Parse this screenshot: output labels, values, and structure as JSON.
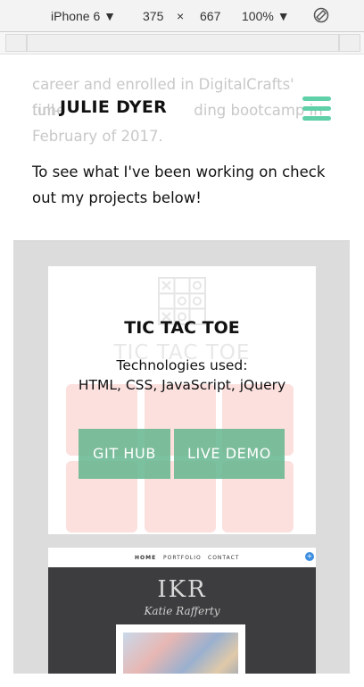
{
  "devtools": {
    "device": "iPhone 6",
    "dropdown_caret": "▼",
    "width": "375",
    "times": "×",
    "height": "667",
    "zoom": "100%",
    "zoom_caret": "▼",
    "rotate_icon": "rotate-icon"
  },
  "header": {
    "brand": "JULIE DYER",
    "menu_icon": "hamburger-icon",
    "accent_color": "#5fd0a8"
  },
  "about": {
    "line1": "career and enrolled in DigitalCrafts' full-",
    "line2_start": "time",
    "line2_end": "ding bootcamp in",
    "line3": "February of 2017.",
    "line4": "To see what I've been working on check",
    "line5": "out my projects below!"
  },
  "projects": [
    {
      "title": "TIC TAC TOE",
      "ghost_title": "TIC TAC TOE",
      "tech_label": "Technologies used:",
      "tech_list": "HTML, CSS, JavaScript, jQuery",
      "github_label": "GIT HUB",
      "demo_label": "LIVE DEMO"
    },
    {
      "nav": [
        "HOME",
        "PORTFOLIO",
        "CONTACT"
      ],
      "nav_badge": "+",
      "logo": "IKR",
      "name": "Katie Rafferty"
    }
  ]
}
